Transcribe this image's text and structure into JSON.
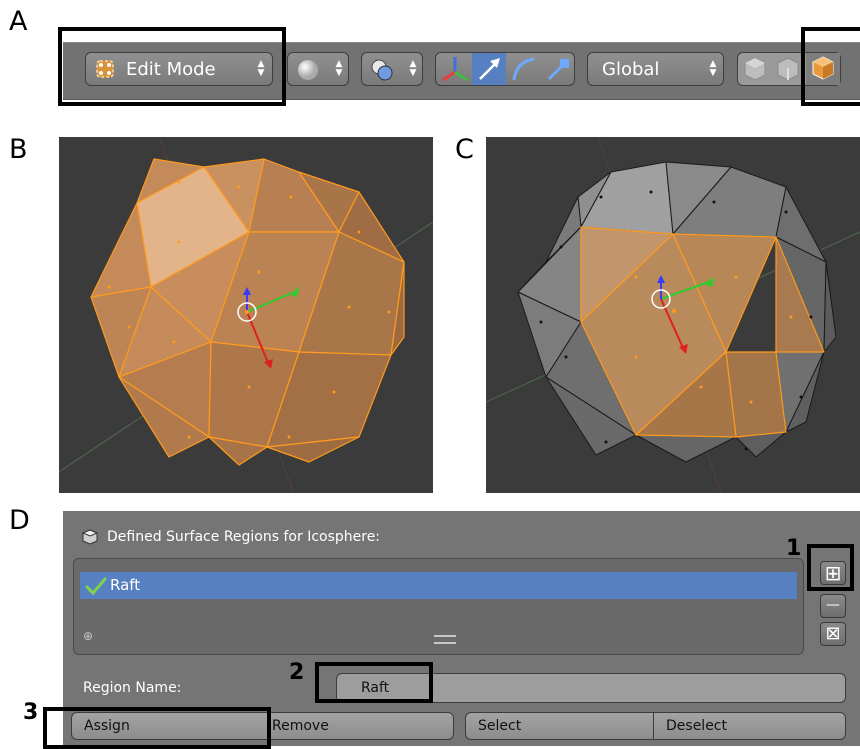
{
  "panel_labels": {
    "a": "A",
    "b": "B",
    "c": "C",
    "d": "D"
  },
  "header": {
    "mode_label": "Edit Mode",
    "orientation_label": "Global"
  },
  "regions_panel": {
    "title": "Defined Surface Regions for Icosphere:",
    "list_items": [
      {
        "label": "Raft",
        "checked": true
      }
    ],
    "add_icon": "plus-icon",
    "remove_icon": "minus-icon",
    "clear_icon": "x-icon",
    "region_name_label": "Region Name:",
    "region_name_value": "Raft",
    "buttons": {
      "assign": "Assign",
      "remove": "Remove",
      "select": "Select",
      "deselect": "Deselect"
    }
  },
  "callouts": {
    "one": "1",
    "two": "2",
    "three": "3"
  },
  "colors": {
    "selection_blue": "#5680c2",
    "face_orange": "#e8a060",
    "edge_orange": "#ff9900",
    "viewport_bg": "#3b3b3b"
  }
}
